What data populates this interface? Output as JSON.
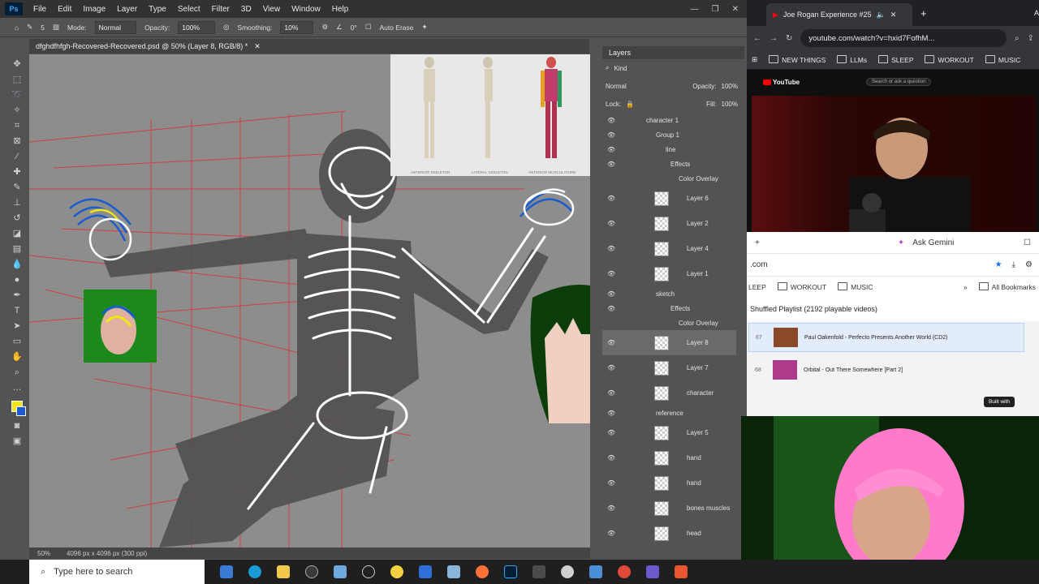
{
  "photoshop": {
    "logo": "Ps",
    "menu": [
      "File",
      "Edit",
      "Image",
      "Layer",
      "Type",
      "Select",
      "Filter",
      "3D",
      "View",
      "Window",
      "Help"
    ],
    "options": {
      "mode_label": "Mode:",
      "mode_value": "Normal",
      "opacity_label": "Opacity:",
      "opacity_value": "100%",
      "smoothing_label": "Smoothing:",
      "smoothing_value": "10%",
      "angle_value": "0°",
      "auto_erase": "Auto Erase",
      "brush_size": "5"
    },
    "document_tab": "dfghdfhfgh-Recovered-Recovered.psd @ 50% (Layer 8, RGB/8) *",
    "status": {
      "zoom": "50%",
      "doc_size": "4096 px x 4096 px (300 ppi)"
    },
    "reference_labels": [
      "ANTERIOR SKELETON",
      "LATERAL SKELETON",
      "ANTERIOR MUSCULATURE"
    ],
    "colors": {
      "foreground": "#f2e614",
      "background": "#1a5ccf",
      "guide_red": "#d9333a"
    },
    "layers_panel": {
      "title": "Layers",
      "filter_kind": "Kind",
      "blend_mode": "Normal",
      "opacity_label": "Opacity:",
      "opacity_value": "100%",
      "lock_label": "Lock:",
      "fill_label": "Fill:",
      "fill_value": "100%",
      "layers": [
        {
          "name": "character 1",
          "type": "group"
        },
        {
          "name": "Group 1",
          "type": "group"
        },
        {
          "name": "line",
          "type": "group"
        },
        {
          "name": "Effects",
          "type": "effects"
        },
        {
          "name": "Color Overlay",
          "type": "effect"
        },
        {
          "name": "Layer 6",
          "type": "layer"
        },
        {
          "name": "Layer 2",
          "type": "layer"
        },
        {
          "name": "Layer 4",
          "type": "layer"
        },
        {
          "name": "Layer 1",
          "type": "layer"
        },
        {
          "name": "sketch",
          "type": "group"
        },
        {
          "name": "Effects",
          "type": "effects"
        },
        {
          "name": "Color Overlay",
          "type": "effect"
        },
        {
          "name": "Layer 8",
          "type": "layer",
          "selected": true
        },
        {
          "name": "Layer 7",
          "type": "layer"
        },
        {
          "name": "character",
          "type": "layer"
        },
        {
          "name": "reference",
          "type": "group"
        },
        {
          "name": "Layer 5",
          "type": "layer"
        },
        {
          "name": "hand",
          "type": "layer"
        },
        {
          "name": "hand",
          "type": "layer"
        },
        {
          "name": "bones muscles",
          "type": "layer"
        },
        {
          "name": "head",
          "type": "layer"
        }
      ]
    }
  },
  "chrome": {
    "tab_title": "Joe Rogan Experience #25",
    "tab2_title": "A",
    "url": "youtube.com/watch?v=hxid7FofhM...",
    "bookmarks": [
      "NEW THINGS",
      "LLMs",
      "SLEEP",
      "WORKOUT",
      "MUSIC"
    ],
    "youtube_logo": "YouTube",
    "search_placeholder": "Search or ask a question"
  },
  "gemini_window": {
    "tab_label": "Ask Gemini",
    "url": ".com",
    "bookmarks": [
      "LEEP",
      "WORKOUT",
      "MUSIC",
      "All Bookmarks"
    ],
    "playlist_title": "Shuffled Playlist (2192 playable videos)",
    "tracks": [
      {
        "num": "67",
        "title": "Paul Oakenfold - Perfecto Presents Another World (CD2)"
      },
      {
        "num": "68",
        "title": "Orbital - Out There Somewhere [Part 2]"
      }
    ],
    "built_with": "Built with"
  },
  "taskbar": {
    "search_placeholder": "Type here to search"
  }
}
